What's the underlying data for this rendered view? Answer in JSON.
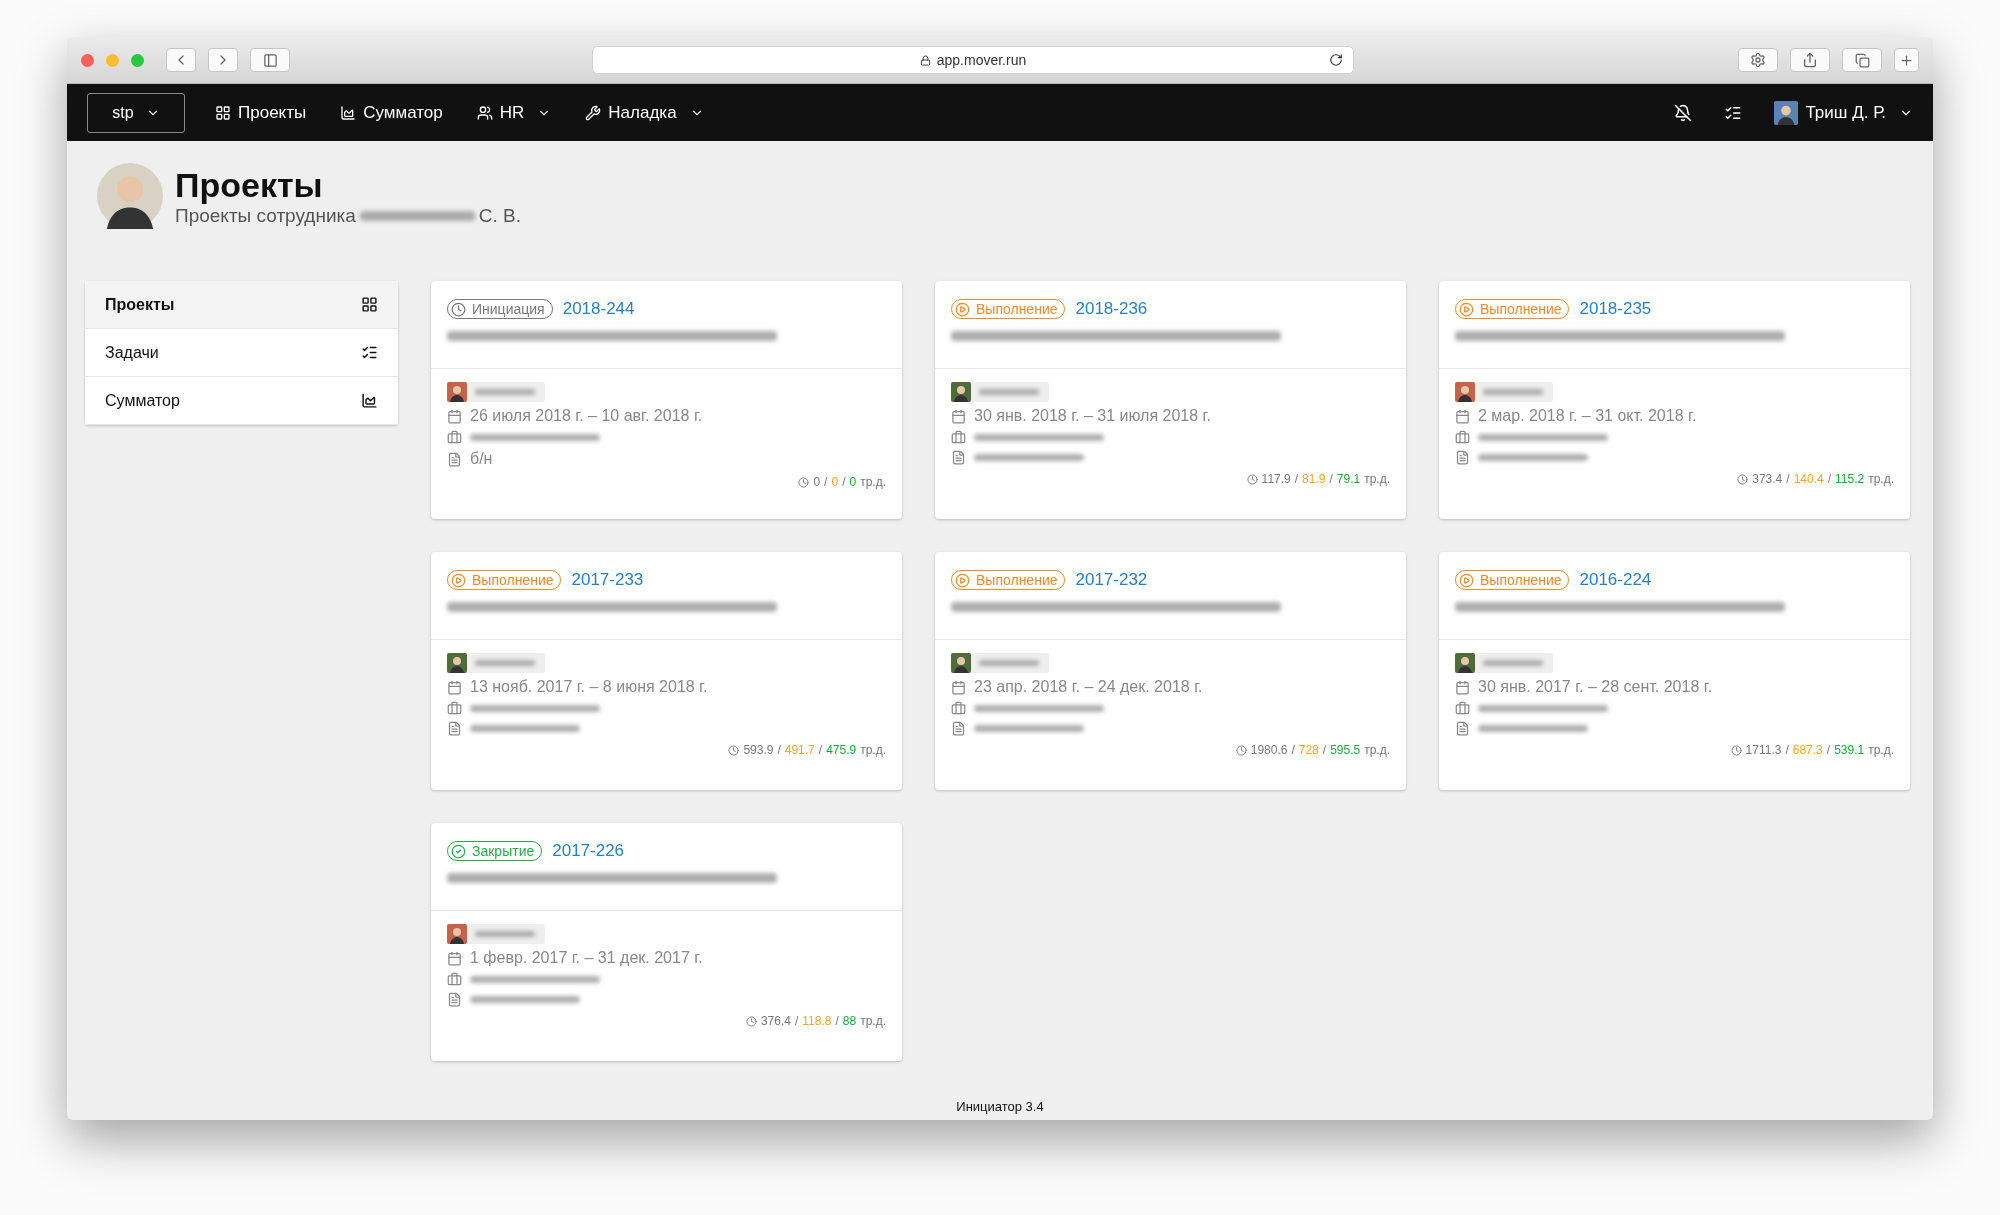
{
  "browser": {
    "url": "app.mover.run"
  },
  "navbar": {
    "org": "stp",
    "items": [
      {
        "label": "Проекты",
        "dropdown": false
      },
      {
        "label": "Сумматор",
        "dropdown": false
      },
      {
        "label": "HR",
        "dropdown": true
      },
      {
        "label": "Наладка",
        "dropdown": true
      }
    ],
    "user": "Триш Д. Р."
  },
  "header": {
    "title": "Проекты",
    "subtitle": "Проекты сотрудника",
    "subtitle_suffix": "С. В."
  },
  "sidebar": {
    "items": [
      {
        "label": "Проекты",
        "selected": true
      },
      {
        "label": "Задачи",
        "selected": false
      },
      {
        "label": "Сумматор",
        "selected": false
      }
    ]
  },
  "cards": [
    {
      "kind": "init",
      "status": "Инициация",
      "code": "2018-244",
      "owner": {
        "color": "#c4634c"
      },
      "separator": "/",
      "dates": "26 июля 2018 г. – 10 авг. 2018 г.",
      "document": "б/н",
      "hours": [
        "0",
        "0",
        "0"
      ],
      "unit": "тр.д."
    },
    {
      "kind": "run",
      "status": "Выполнение",
      "code": "2018-236",
      "owner": {
        "color": "#4f6b3a"
      },
      "separator": "/",
      "dates": "30 янв. 2018 г. – 31 июля 2018 г.",
      "hours": [
        "117.9",
        "81.9",
        "79.1"
      ],
      "unit": "тр.д."
    },
    {
      "kind": "run",
      "status": "Выполнение",
      "code": "2018-235",
      "owner": {
        "color": "#c4634c"
      },
      "separator": "/",
      "dates": "2 мар. 2018 г. – 31 окт. 2018 г.",
      "hours": [
        "373.4",
        "140.4",
        "115.2"
      ],
      "unit": "тр.д."
    },
    {
      "kind": "run",
      "status": "Выполнение",
      "code": "2017-233",
      "owner": {
        "color": "#4f6b3a"
      },
      "separator": "/",
      "dates": "13 нояб. 2017 г. – 8 июня 2018 г.",
      "hours": [
        "593.9",
        "491.7",
        "475.9"
      ],
      "unit": "тр.д."
    },
    {
      "kind": "run",
      "status": "Выполнение",
      "code": "2017-232",
      "owner": {
        "color": "#4f6b3a"
      },
      "separator": "/",
      "dates": "23 апр. 2018 г. – 24 дек. 2018 г.",
      "hours": [
        "1980.6",
        "728",
        "595.5"
      ],
      "unit": "тр.д."
    },
    {
      "kind": "run",
      "status": "Выполнение",
      "code": "2016-224",
      "owner": {
        "color": "#4f6b3a"
      },
      "separator": "/",
      "dates": "30 янв. 2017 г. – 28 сент. 2018 г.",
      "hours": [
        "1711.3",
        "687.3",
        "539.1"
      ],
      "unit": "тр.д."
    },
    {
      "kind": "closed",
      "status": "Закрытие",
      "code": "2017-226",
      "owner": {
        "color": "#c4634c"
      },
      "separator": "/",
      "dates": "1 февр. 2017 г. – 31 дек. 2017 г.",
      "hours": [
        "376.4",
        "118.8",
        "88"
      ],
      "unit": "тр.д."
    }
  ],
  "footer": "Инициатор 3.4"
}
